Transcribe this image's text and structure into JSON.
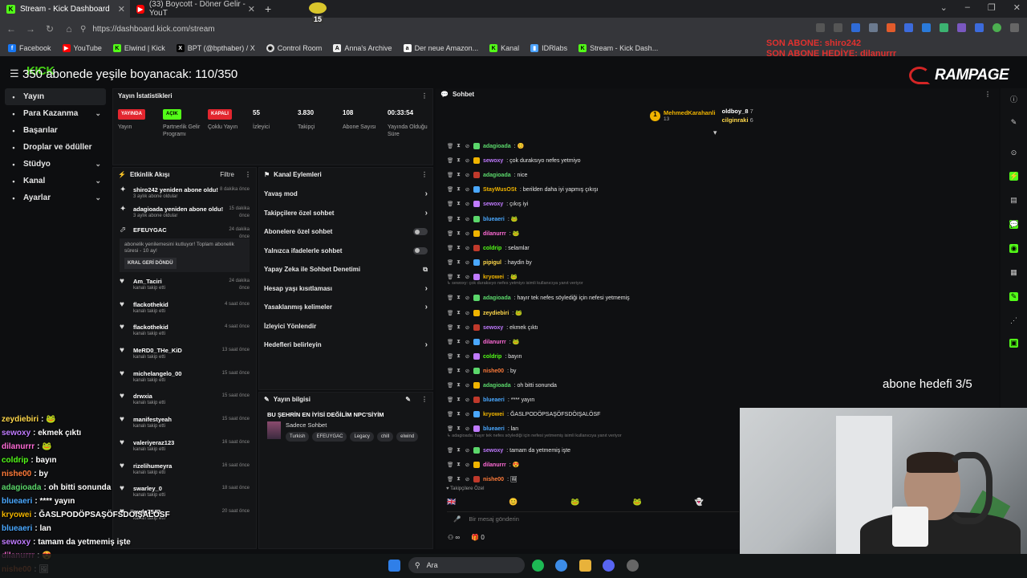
{
  "browser": {
    "tabs": [
      {
        "title": "Stream - Kick Dashboard",
        "favicon": "kick-icon",
        "active": true
      },
      {
        "title": "(33) Boycott - Döner Gelir - YouT",
        "favicon": "youtube-icon",
        "active": false
      }
    ],
    "url": "https://dashboard.kick.com/stream",
    "bookmarks": [
      "Facebook",
      "YouTube",
      "Elwind | Kick",
      "BPT (@bpthaber) / X",
      "Control Room",
      "Anna's Archive",
      "Der neue Amazon...",
      "Kanal",
      "IDRlabs",
      "Stream - Kick Dash..."
    ]
  },
  "overlay": {
    "goal_text": "350 abonede yeşile boyanacak: 110/350",
    "last_sub": "SON ABONE: shiro242",
    "last_gift": "SON ABONE HEDİYE: dilanurrr",
    "brand": "RAMPAGE",
    "sub_goal": "abone hedefi 3/5",
    "counter_badge": "15"
  },
  "sidebar": {
    "items": [
      {
        "label": "Yayın",
        "icon": "broadcast-icon",
        "active": true,
        "chev": false
      },
      {
        "label": "Para Kazanma",
        "icon": "money-icon",
        "active": false,
        "chev": true
      },
      {
        "label": "Başarılar",
        "icon": "trophy-icon",
        "active": false,
        "chev": false
      },
      {
        "label": "Droplar ve ödüller",
        "icon": "gift-icon",
        "active": false,
        "chev": false
      },
      {
        "label": "Stüdyo",
        "icon": "studio-icon",
        "active": false,
        "chev": true
      },
      {
        "label": "Kanal",
        "icon": "channel-icon",
        "active": false,
        "chev": true
      },
      {
        "label": "Ayarlar",
        "icon": "gear-icon",
        "active": false,
        "chev": true
      }
    ]
  },
  "stats": {
    "title": "Yayın İstatistikleri",
    "cols": [
      {
        "badge": "YAYINDA",
        "label": "Yayın",
        "kind": "red"
      },
      {
        "badge": "AÇIK",
        "label": "Partnerlik Gelir Programı",
        "kind": "green"
      },
      {
        "badge": "KAPALI",
        "label": "Çoklu Yayın",
        "kind": "red"
      },
      {
        "value": "55",
        "label": "İzleyici"
      },
      {
        "value": "3.830",
        "label": "Takipçi"
      },
      {
        "value": "108",
        "label": "Abone Sayısı"
      },
      {
        "value": "00:33:54",
        "label": "Yayında Olduğu Süre"
      }
    ]
  },
  "activity": {
    "title": "Etkinlik Akışı",
    "filter": "Filtre",
    "resubs": [
      {
        "name": "shiro242 yeniden abone oldu!",
        "sub": "3 aylık abone oldular",
        "time": "8 dakika önce"
      },
      {
        "name": "adagioada yeniden abone oldu!",
        "sub": "3 aylık abone oldular",
        "time": "15 dakika önce"
      }
    ],
    "efe": {
      "name": "EFEUYGAC",
      "time": "24 dakika önce",
      "text": "abonelik yenilemesini kutluyor! Toplam abonelik süresi - 10 ay!",
      "reward": "KRAL GERİ DÖNDÜ"
    },
    "follows_sub": "kanalı takip etti",
    "follows": [
      {
        "name": "Am_Taciri",
        "time": "24 dakika önce"
      },
      {
        "name": "flackothekid",
        "time": "4 saat önce"
      },
      {
        "name": "flackothekid",
        "time": "4 saat önce"
      },
      {
        "name": "MeRD0_THe_KiD",
        "time": "13 saat önce"
      },
      {
        "name": "michelangelo_00",
        "time": "15 saat önce"
      },
      {
        "name": "drwxia",
        "time": "15 saat önce"
      },
      {
        "name": "manifestyeah",
        "time": "15 saat önce"
      },
      {
        "name": "valeriyeraz123",
        "time": "16 saat önce"
      },
      {
        "name": "rizelihumeyra",
        "time": "16 saat önce"
      },
      {
        "name": "swarley_0",
        "time": "18 saat önce"
      },
      {
        "name": "sude7542",
        "time": "20 saat önce"
      }
    ]
  },
  "channel_actions": {
    "title": "Kanal Eylemleri",
    "items": [
      {
        "label": "Yavaş mod",
        "kind": "arrow"
      },
      {
        "label": "Takipçilere özel sohbet",
        "kind": "arrow"
      },
      {
        "label": "Abonelere özel sohbet",
        "kind": "toggle"
      },
      {
        "label": "Yalnızca ifadelerle sohbet",
        "kind": "toggle"
      },
      {
        "label": "Yapay Zeka ile Sohbet Denetimi",
        "kind": "ext"
      },
      {
        "label": "Hesap yaşı kısıtlaması",
        "kind": "arrow"
      },
      {
        "label": "Yasaklanmış kelimeler",
        "kind": "arrow"
      },
      {
        "label": "İzleyici Yönlendir",
        "kind": "none"
      },
      {
        "label": "Hedefleri belirleyin",
        "kind": "arrow"
      }
    ]
  },
  "stream_info": {
    "title": "Yayın bilgisi",
    "stream_title": "BU ŞEHRİN EN İYİSİ DEĞİLİM NPC'SİYİM",
    "category": "Sadece Sohbet",
    "tags": [
      "Turkish",
      "EFEUYGAC",
      "Legacy",
      "chill",
      "elwind"
    ]
  },
  "chat": {
    "title": "Sohbet",
    "pinned": [
      {
        "name": "MehmedKarahanli",
        "count": "13"
      },
      {
        "name": "oldboy_8",
        "count": "7"
      },
      {
        "name": "cilginraki",
        "count": "6"
      }
    ],
    "lines": [
      {
        "user": "adagioada",
        "color": "#5bd76b",
        "msg": ": 😊"
      },
      {
        "user": "sewoxy",
        "color": "#c07bff",
        "msg": ": çok duraksıyo nefes yetmiyo"
      },
      {
        "user": "adagioada",
        "color": "#5bd76b",
        "msg": ": nice"
      },
      {
        "user": "StayWusOSt",
        "color": "#f0b400",
        "msg": ": berilden daha iyi yapmış çıkışı"
      },
      {
        "user": "sewoxy",
        "color": "#c07bff",
        "msg": ": çıkış iyi"
      },
      {
        "user": "blueaeri",
        "color": "#4aa8ff",
        "msg": ": 🐸"
      },
      {
        "user": "dilanurrr",
        "color": "#ff6bd6",
        "msg": ": 🐸"
      },
      {
        "user": "coldrip",
        "color": "#53fc18",
        "msg": ": selamlar"
      },
      {
        "user": "pipigul",
        "color": "#ffd84a",
        "msg": ": haydin by"
      },
      {
        "user": "kryowei",
        "color": "#f0b400",
        "msg": ": 🐸"
      },
      {
        "user": "adagioada",
        "color": "#5bd76b",
        "msg": ": hayır tek nefes söylediği için nefesi yetmemiş"
      },
      {
        "user": "zeydiebiri",
        "color": "#ffd84a",
        "msg": ": 🐸"
      },
      {
        "user": "sewoxy",
        "color": "#c07bff",
        "msg": ": ekmek çıktı"
      },
      {
        "user": "dilanurrr",
        "color": "#ff6bd6",
        "msg": ": 🐸"
      },
      {
        "user": "coldrip",
        "color": "#53fc18",
        "msg": ": bayın"
      },
      {
        "user": "nishe00",
        "color": "#ff7b3a",
        "msg": ": by"
      },
      {
        "user": "adagioada",
        "color": "#5bd76b",
        "msg": ": oh bitti sonunda"
      },
      {
        "user": "blueaeri",
        "color": "#4aa8ff",
        "msg": ": **** yayın"
      },
      {
        "user": "kryowei",
        "color": "#f0b400",
        "msg": ": ĞASLPODÖPSAŞÖFSDÖIŞALÖSF"
      },
      {
        "user": "blueaeri",
        "color": "#4aa8ff",
        "msg": ": lan"
      },
      {
        "user": "sewoxy",
        "color": "#c07bff",
        "msg": ": tamam da yetmemiş işte"
      },
      {
        "user": "dilanurrr",
        "color": "#ff6bd6",
        "msg": ": 😍"
      },
      {
        "user": "nishe00",
        "color": "#ff7b3a",
        "msg": ": 🖼"
      }
    ],
    "reply1": "↳ sewoxy: çok duraksıyo nefes yetmiyo isimli kullanıcıya yanıt veriyor",
    "reply2": "↳ adagioada: hayır tek nefes söylediği için nefesi yetmemiş isimli kullanıcıya yanıt veriyor",
    "follower_only": "♥ Takipçilere Özel",
    "input_placeholder": "Bir mesaj gönderin",
    "foot_left": "∞",
    "foot_right": "0"
  },
  "overlay_chat": [
    {
      "user": "zeydiebiri",
      "color": "#ffd84a",
      "msg": " : 🐸"
    },
    {
      "user": "sewoxy",
      "color": "#c07bff",
      "msg": " : ekmek çıktı"
    },
    {
      "user": "dilanurrr",
      "color": "#ff6bd6",
      "msg": " : 🐸"
    },
    {
      "user": "coldrip",
      "color": "#53fc18",
      "msg": " : bayın"
    },
    {
      "user": "nishe00",
      "color": "#ff7b3a",
      "msg": " : by"
    },
    {
      "user": "adagioada",
      "color": "#5bd76b",
      "msg": " : oh bitti sonunda"
    },
    {
      "user": "blueaeri",
      "color": "#4aa8ff",
      "msg": " : **** yayın"
    },
    {
      "user": "kryowei",
      "color": "#f0b400",
      "msg": " : ĞASLPODÖPSAŞÖFSDÖIŞALÖSF"
    },
    {
      "user": "blueaeri",
      "color": "#4aa8ff",
      "msg": " : lan"
    },
    {
      "user": "sewoxy",
      "color": "#c07bff",
      "msg": " : tamam da yetmemiş işte"
    },
    {
      "user": "dilanurrr",
      "color": "#ff6bd6",
      "msg": " : 😍"
    },
    {
      "user": "nishe00",
      "color": "#ff7b3a",
      "msg": " : 🖼"
    }
  ],
  "taskbar": {
    "search_placeholder": "Ara"
  },
  "colors": {
    "kick_green": "#53fc18",
    "live_red": "#e3262f",
    "overlay_red": "#e0312f"
  }
}
